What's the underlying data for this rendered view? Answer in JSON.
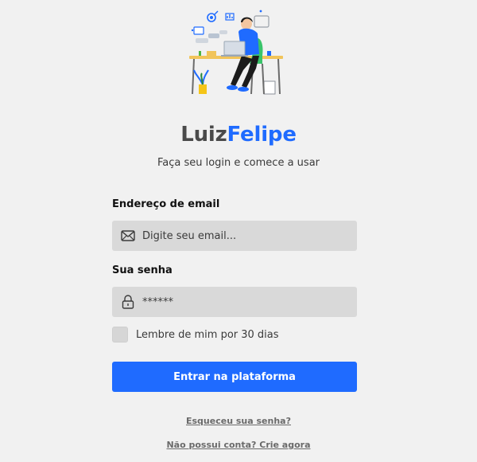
{
  "illustration": {
    "icon": "person-at-desk-with-laptop-illustration"
  },
  "brand": {
    "part1": "Luiz",
    "part2": "Felipe",
    "color_dark": "#4a4a4a",
    "color_accent": "#1f6bff"
  },
  "subtitle": "Faça seu login e comece a usar",
  "email": {
    "label": "Endereço de email",
    "placeholder": "Digite seu email...",
    "value": "",
    "icon": "envelope-icon"
  },
  "password": {
    "label": "Sua senha",
    "value": "******",
    "icon": "lock-icon"
  },
  "remember": {
    "label": "Lembre de mim por 30 dias",
    "checked": false
  },
  "submit": {
    "label": "Entrar na plataforma",
    "color": "#1f6bff"
  },
  "links": {
    "forgot": "Esqueceu sua senha?",
    "signup": "Não possui conta? Crie agora"
  }
}
